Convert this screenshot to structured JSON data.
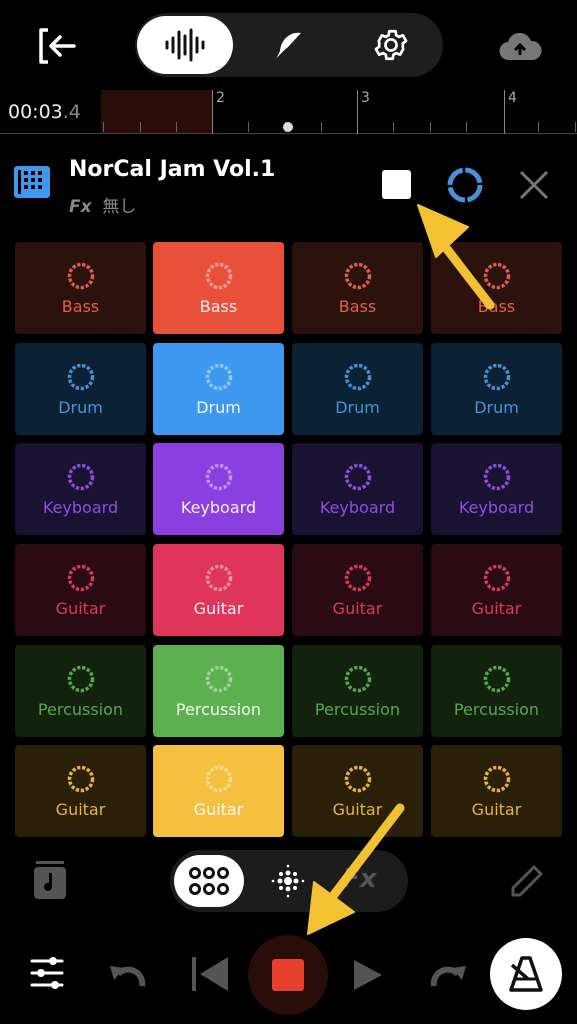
{
  "header": {
    "exit_icon": "exit-icon",
    "tabs": [
      {
        "icon": "waveform-icon",
        "active": true
      },
      {
        "icon": "feather-icon"
      },
      {
        "icon": "gear-icon"
      }
    ],
    "upload_icon": "cloud-upload-icon"
  },
  "timeline": {
    "time_main": "00:03",
    "time_frac": ".4",
    "markers": [
      "2",
      "3",
      "4"
    ]
  },
  "track": {
    "title": "NorCal Jam Vol.1",
    "fx_label": "Fx",
    "fx_value": "無し",
    "icon": "drum-pad-icon",
    "stop_icon": "stop-icon",
    "loop_icon": "loop-circle-icon",
    "close_icon": "close-icon"
  },
  "pads": {
    "active_column": 2,
    "columns": 4,
    "rows": [
      {
        "label": "Bass",
        "color": "#e8503a",
        "dark": "#2c120d",
        "text": "#e06048"
      },
      {
        "label": "Drum",
        "color": "#3f98ef",
        "dark": "#0b2234",
        "text": "#4a90d8"
      },
      {
        "label": "Keyboard",
        "color": "#8a3fe0",
        "dark": "#1a1232",
        "text": "#8c50e0"
      },
      {
        "label": "Guitar",
        "color": "#e0355a",
        "dark": "#2a0b14",
        "text": "#d83a5c"
      },
      {
        "label": "Percussion",
        "color": "#5cb050",
        "dark": "#13220f",
        "text": "#56a84a"
      },
      {
        "label": "Guitar",
        "color": "#f5c040",
        "dark": "#2a1f08",
        "text": "#e8b43e"
      }
    ]
  },
  "bottom": {
    "library_icon": "music-library-icon",
    "modes": [
      {
        "icon": "pad-grid-icon",
        "active": true
      },
      {
        "icon": "sequencer-icon"
      },
      {
        "label": "Fx"
      }
    ],
    "edit_icon": "pencil-icon"
  },
  "transport": {
    "mixer_icon": "sliders-icon",
    "undo_icon": "undo-icon",
    "rewind_icon": "skip-back-icon",
    "record_stop_icon": "stop-icon",
    "play_icon": "play-icon",
    "redo_icon": "redo-icon",
    "metronome_icon": "metronome-icon",
    "record_color": "#e8402e"
  },
  "annotations": {
    "arrow_color": "#f2c232"
  }
}
